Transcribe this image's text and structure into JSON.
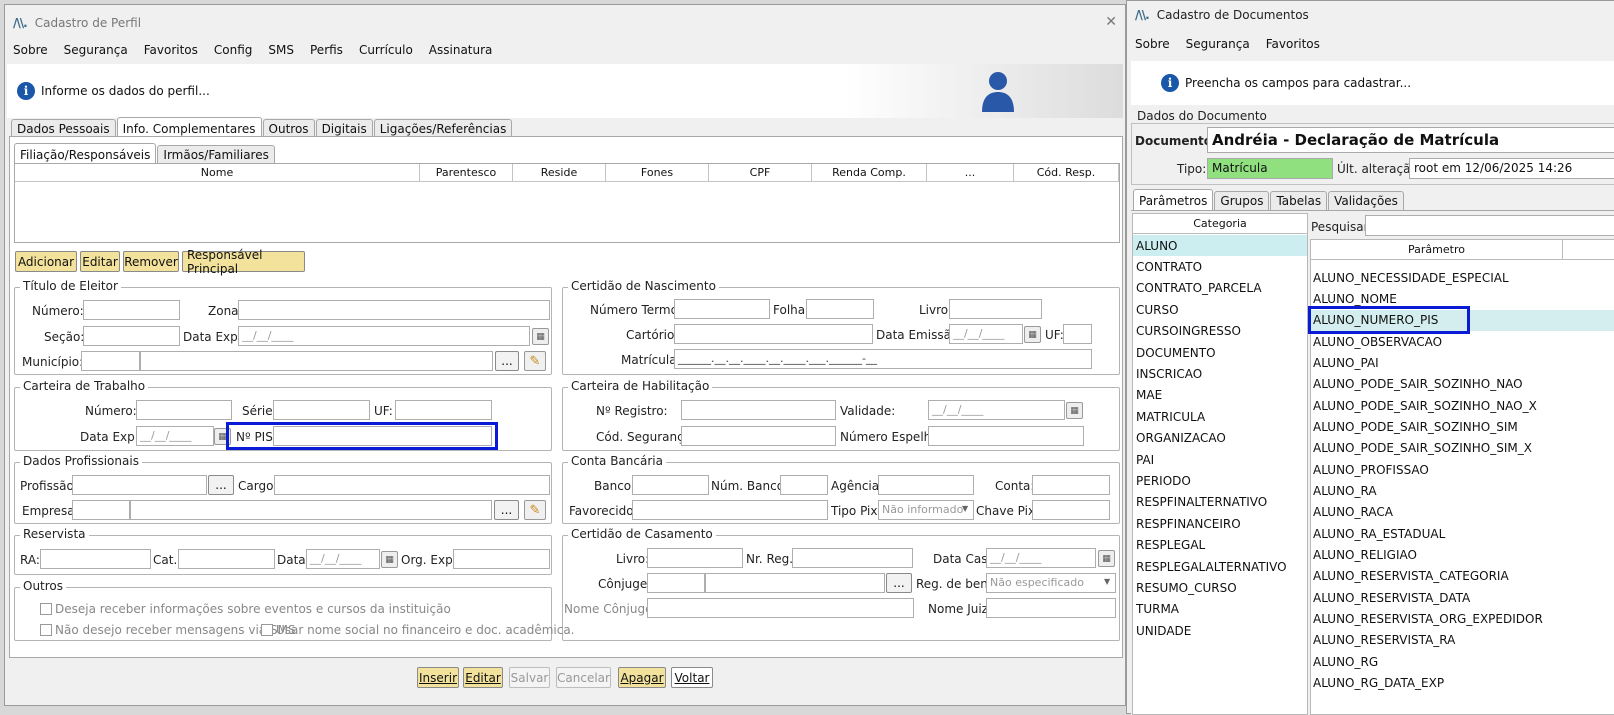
{
  "left": {
    "title": "Cadastro de Perfil",
    "logo": "/\\\\.",
    "close": "✕",
    "menu": [
      "Sobre",
      "Segurança",
      "Favoritos",
      "Config",
      "SMS",
      "Perfis",
      "Currículo",
      "Assinatura"
    ],
    "info": "Informe os dados do perfil...",
    "tabs": [
      "Dados Pessoais",
      "Info. Complementares",
      "Outros",
      "Digitais",
      "Ligações/Referências"
    ],
    "subtabs": [
      "Filiação/Responsáveis",
      "Irmãos/Familiares"
    ],
    "grid_headers": [
      "Nome",
      "Parentesco",
      "Reside",
      "Fones",
      "CPF",
      "Renda Comp.",
      "...",
      "Cód. Resp."
    ],
    "grid_buttons": [
      "Adicionar",
      "Editar",
      "Remover",
      "Responsável Principal"
    ],
    "titulo": {
      "legend": "Título de Eleitor",
      "numero": "Número:",
      "zona": "Zona:",
      "secao": "Seção:",
      "data_exp": "Data Exp.:",
      "date_mask": "__/__/____",
      "municipio": "Município:"
    },
    "certidao_nasc": {
      "legend": "Certidão de Nascimento",
      "numero_termo": "Número Termo:",
      "folha": "Folha:",
      "livro": "Livro:",
      "cartorio": "Cartório:",
      "data_emissao": "Data Emissão:",
      "uf": "UF:",
      "matricula": "Matrícula:",
      "matricula_mask": "______.__.__.____.__.____.___.______-__"
    },
    "carteira_trabalho": {
      "legend": "Carteira de Trabalho",
      "numero": "Número:",
      "serie": "Série:",
      "uf": "UF:",
      "data_exp": "Data Exp.:",
      "pis": "Nº PIS:"
    },
    "carteira_hab": {
      "legend": "Carteira de Habilitação",
      "registro": "Nº Registro:",
      "validade": "Validade:",
      "cod_seg": "Cód. Segurança:",
      "num_espelho": "Número Espelho:"
    },
    "dados_prof": {
      "legend": "Dados Profissionais",
      "profissao": "Profissão:",
      "cargo": "Cargo:",
      "empresa": "Empresa:"
    },
    "conta": {
      "legend": "Conta Bancária",
      "banco": "Banco:",
      "num_banco": "Núm. Banco:",
      "agencia": "Agência:",
      "conta": "Conta:",
      "favorecido": "Favorecido:",
      "tipo_pix": "Tipo Pix:",
      "tipo_pix_value": "Não informado",
      "chave_pix": "Chave Pix:"
    },
    "reservista": {
      "legend": "Reservista",
      "ra": "RA:",
      "cat": "Cat.:",
      "data": "Data:",
      "org": "Org. Exp.:"
    },
    "casamento": {
      "legend": "Certidão de Casamento",
      "livro": "Livro:",
      "nr_reg": "Nr. Reg.:",
      "data_cas": "Data Cas.:",
      "conjuge": "Cônjuge:",
      "reg_bens": "Reg. de bens:",
      "reg_bens_value": "Não especificado",
      "nome_conjuge": "Nome Cônjuge:",
      "nome_juiz": "Nome Juiz:"
    },
    "outros": {
      "legend": "Outros",
      "opt1": "Deseja receber informações sobre eventos e cursos da instituição",
      "opt2": "Não desejo receber mensagens via SMS",
      "opt3": "Usar nome social no financeiro e doc. acadêmica."
    },
    "ellipsis": "...",
    "footer_buttons": [
      "Inserir",
      "Editar",
      "Salvar",
      "Cancelar",
      "Apagar",
      "Voltar"
    ]
  },
  "right": {
    "title": "Cadastro de Documentos",
    "logo": "/\\\\.",
    "menu": [
      "Sobre",
      "Segurança",
      "Favoritos"
    ],
    "info": "Preencha os campos para cadastrar...",
    "group": "Dados do Documento",
    "documento_label": "Documento:",
    "documento_value": "Andréia - Declaração de Matrícula",
    "tipo_label": "Tipo:",
    "tipo_value": "Matrícula",
    "ult_label": "Últ. alteração:",
    "ult_value": "root em 12/06/2025 14:26",
    "tabs": [
      "Parâmetros",
      "Grupos",
      "Tabelas",
      "Validações"
    ],
    "cat_header": "Categoria",
    "pesquisar": "Pesquisar:",
    "par_header": "Parâmetro",
    "categories": [
      "ALUNO",
      "CONTRATO",
      "CONTRATO_PARCELA",
      "CURSO",
      "CURSOINGRESSO",
      "DOCUMENTO",
      "INSCRICAO",
      "MAE",
      "MATRICULA",
      "ORGANIZACAO",
      "PAI",
      "PERIODO",
      "RESPFINALTERNATIVO",
      "RESPFINANCEIRO",
      "RESPLEGAL",
      "RESPLEGALALTERNATIVO",
      "RESUMO_CURSO",
      "TURMA",
      "UNIDADE"
    ],
    "params": [
      "ALUNO_NECESSIDADE_ESPECIAL",
      "ALUNO_NOME",
      "ALUNO_NUMERO_PIS",
      "ALUNO_OBSERVACAO",
      "ALUNO_PAI",
      "ALUNO_PODE_SAIR_SOZINHO_NAO",
      "ALUNO_PODE_SAIR_SOZINHO_NAO_X",
      "ALUNO_PODE_SAIR_SOZINHO_SIM",
      "ALUNO_PODE_SAIR_SOZINHO_SIM_X",
      "ALUNO_PROFISSAO",
      "ALUNO_RA",
      "ALUNO_RACA",
      "ALUNO_RA_ESTADUAL",
      "ALUNO_RELIGIAO",
      "ALUNO_RESERVISTA_CATEGORIA",
      "ALUNO_RESERVISTA_DATA",
      "ALUNO_RESERVISTA_ORG_EXPEDIDOR",
      "ALUNO_RESERVISTA_RA",
      "ALUNO_RG",
      "ALUNO_RG_DATA_EXP"
    ],
    "colors": {
      "tipo_bg": "#90e07f",
      "selected_cat": "#cdeef0",
      "selected_param": "#d4eef0",
      "highlight": "#0a1bd6"
    }
  }
}
